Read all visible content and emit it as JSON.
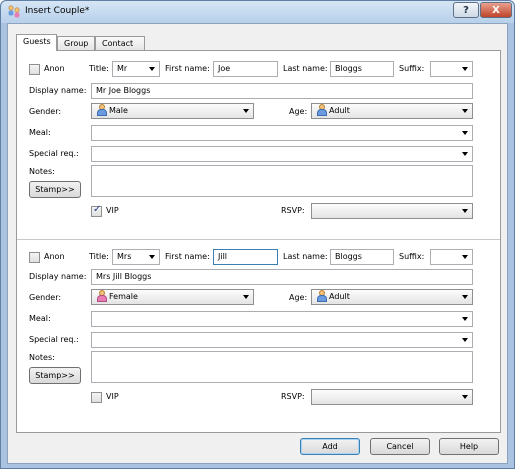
{
  "window": {
    "title": "Insert Couple*",
    "help_glyph": "?",
    "close_glyph": "X"
  },
  "tabs": [
    "Guests",
    "Group",
    "Contact"
  ],
  "labels": {
    "anon": "Anon",
    "title": "Title:",
    "first_name": "First name:",
    "last_name": "Last name:",
    "suffix": "Suffix:",
    "display_name": "Display name:",
    "gender": "Gender:",
    "age": "Age:",
    "meal": "Meal:",
    "special_req": "Special req.:",
    "notes": "Notes:",
    "stamp": "Stamp>>",
    "vip": "VIP",
    "rsvp": "RSVP:"
  },
  "guests": [
    {
      "anon": false,
      "title": "Mr",
      "first_name": "Joe",
      "last_name": "Bloggs",
      "suffix": "",
      "display_name": "Mr Joe Bloggs",
      "gender": "Male",
      "age": "Adult",
      "meal": "",
      "special_req": "",
      "notes": "",
      "vip": true,
      "rsvp": ""
    },
    {
      "anon": false,
      "title": "Mrs",
      "first_name": "Jill",
      "last_name": "Bloggs",
      "suffix": "",
      "display_name": "Mrs Jill Bloggs",
      "gender": "Female",
      "age": "Adult",
      "meal": "",
      "special_req": "",
      "notes": "",
      "vip": false,
      "rsvp": ""
    }
  ],
  "buttons": {
    "add": "Add",
    "cancel": "Cancel",
    "help": "Help"
  },
  "icons": {
    "app": "couple-icon",
    "male": "male-person-icon",
    "female": "female-person-icon",
    "adult": "adult-person-icon"
  }
}
